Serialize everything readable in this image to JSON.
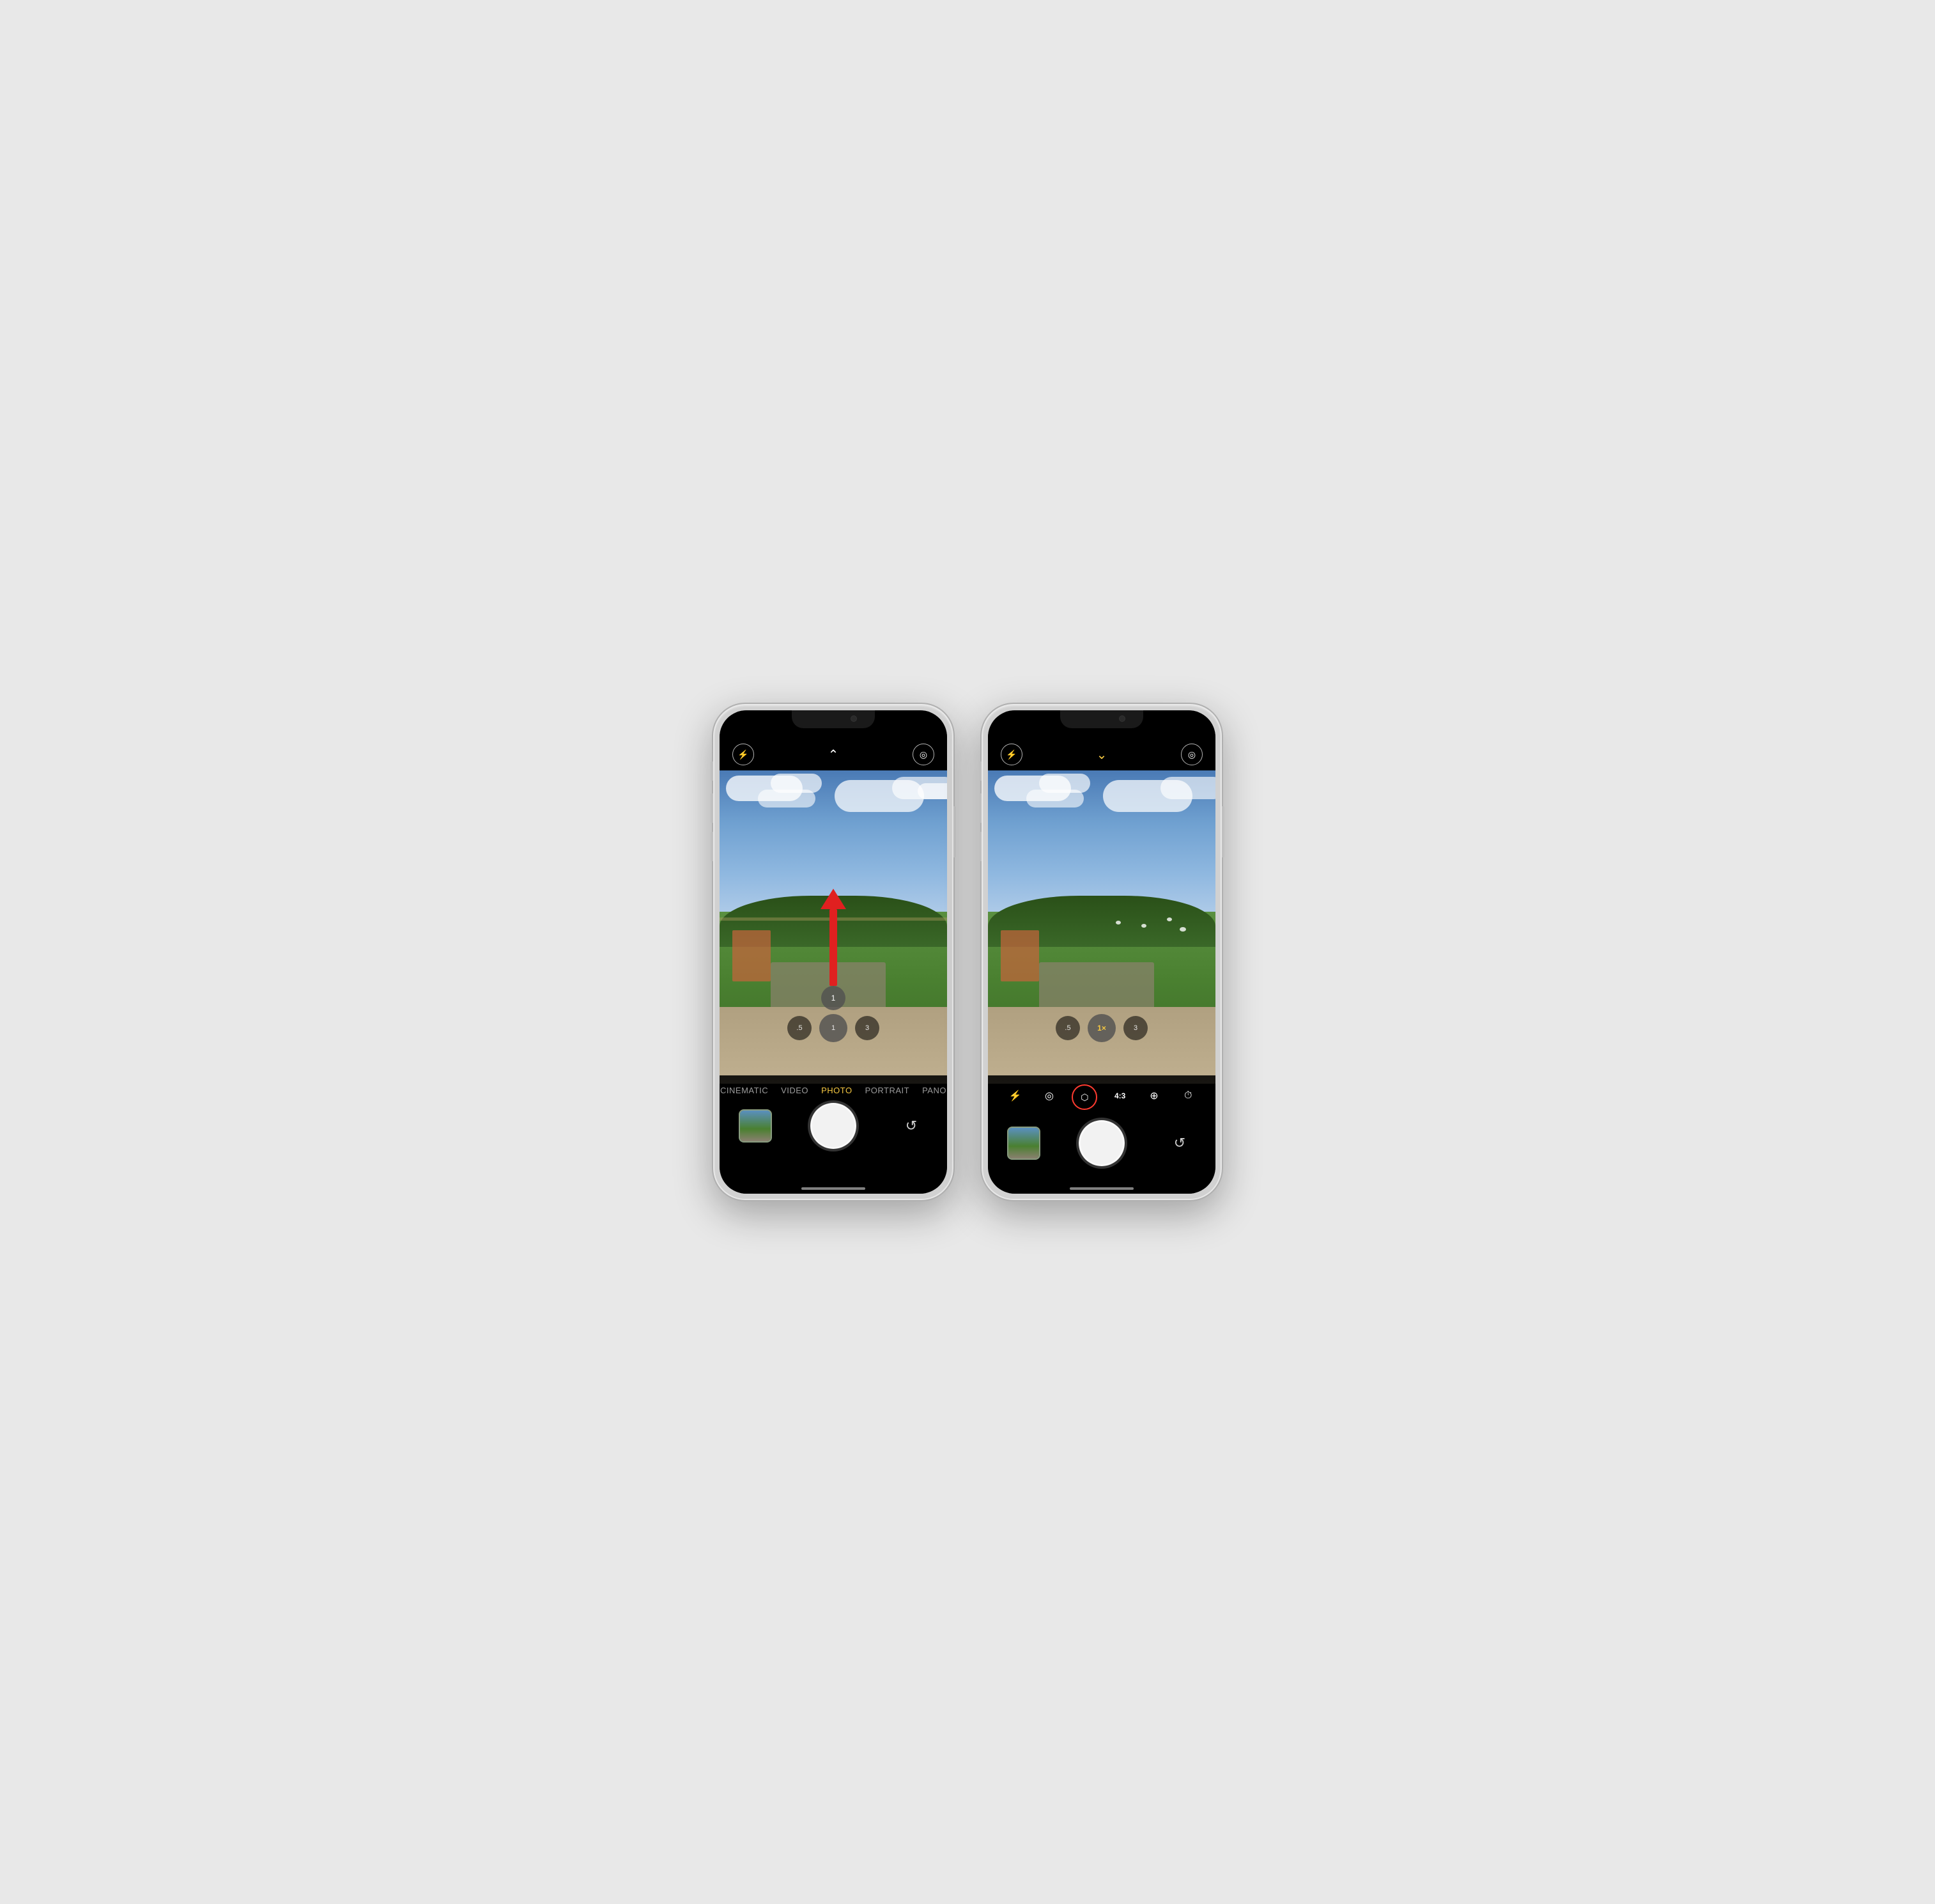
{
  "phones": [
    {
      "id": "phone-left",
      "top_controls": {
        "flash_icon": "⚡",
        "center_icon": "∧",
        "live_icon": "◎"
      },
      "center_chevron_direction": "up",
      "mode_selector": {
        "modes": [
          "CINEMATIC",
          "VIDEO",
          "PHOTO",
          "PORTRAIT",
          "PANO"
        ],
        "active": "PHOTO"
      },
      "zoom": {
        "options": [
          ".5",
          "1",
          "3"
        ],
        "active": "1"
      },
      "has_arrow": true,
      "has_letterbox": false,
      "has_toolbar": false,
      "arrow": {
        "label": "swipe up"
      }
    },
    {
      "id": "phone-right",
      "top_controls": {
        "flash_icon": "⚡",
        "center_icon": "∨",
        "live_icon": "◎"
      },
      "center_chevron_direction": "down",
      "center_chevron_color": "#f5c842",
      "mode_selector": null,
      "zoom": {
        "options": [
          ".5",
          "1×",
          "3"
        ],
        "active": "1×"
      },
      "has_arrow": false,
      "has_letterbox": false,
      "has_toolbar": true,
      "toolbar": {
        "items": [
          "⚡",
          "◎",
          "⧉",
          "4:3",
          "⊕",
          "⏱"
        ]
      }
    }
  ],
  "colors": {
    "active_mode": "#f5c842",
    "inactive_mode": "rgba(255,255,255,0.6)",
    "shutter_white": "#ffffff",
    "highlight_red": "#e02020",
    "toolbar_highlight": "#ff3b30",
    "background": "#e8e8e8"
  }
}
